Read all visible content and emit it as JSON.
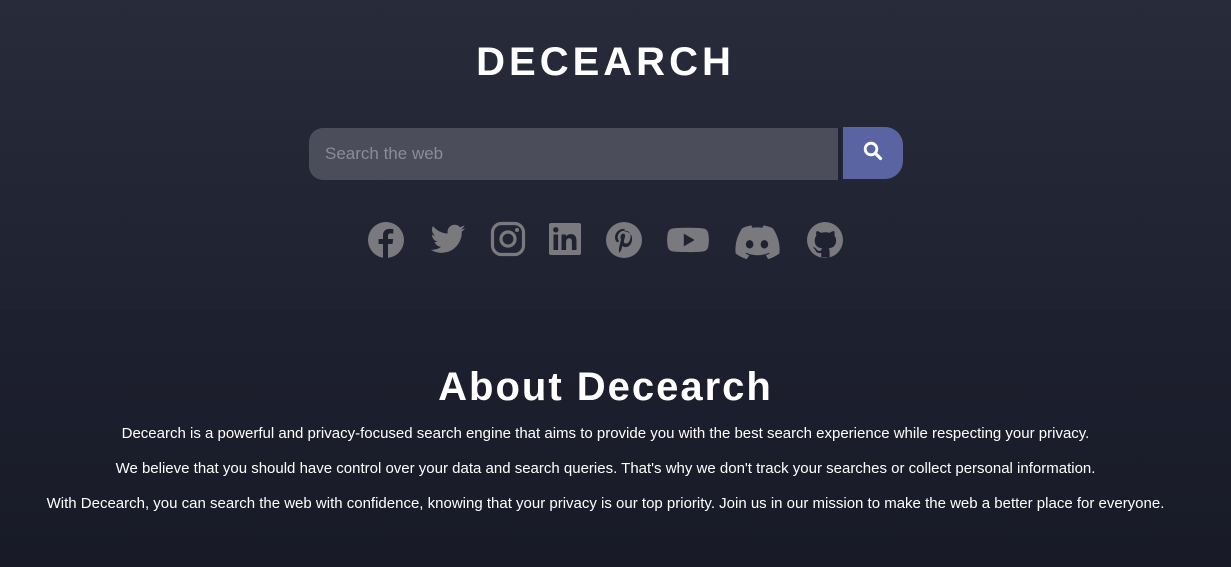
{
  "header": {
    "logo_text": "DECEARCH"
  },
  "search": {
    "placeholder": "Search the web",
    "value": "",
    "button_icon": "search-icon",
    "button_color": "#5a64a2"
  },
  "social_links": [
    {
      "name": "facebook",
      "icon": "facebook-icon"
    },
    {
      "name": "twitter",
      "icon": "twitter-icon"
    },
    {
      "name": "instagram",
      "icon": "instagram-icon"
    },
    {
      "name": "linkedin",
      "icon": "linkedin-icon"
    },
    {
      "name": "pinterest",
      "icon": "pinterest-icon"
    },
    {
      "name": "youtube",
      "icon": "youtube-icon"
    },
    {
      "name": "discord",
      "icon": "discord-icon"
    },
    {
      "name": "github",
      "icon": "github-icon"
    }
  ],
  "social_icon_color": "#7a7a7e",
  "about": {
    "title": "About Decearch",
    "paragraphs": [
      "Decearch is a powerful and privacy-focused search engine that aims to provide you with the best search experience while respecting your privacy.",
      "We believe that you should have control over your data and search queries. That's why we don't track your searches or collect personal information.",
      "With Decearch, you can search the web with confidence, knowing that your privacy is our top priority. Join us in our mission to make the web a better place for everyone."
    ]
  }
}
